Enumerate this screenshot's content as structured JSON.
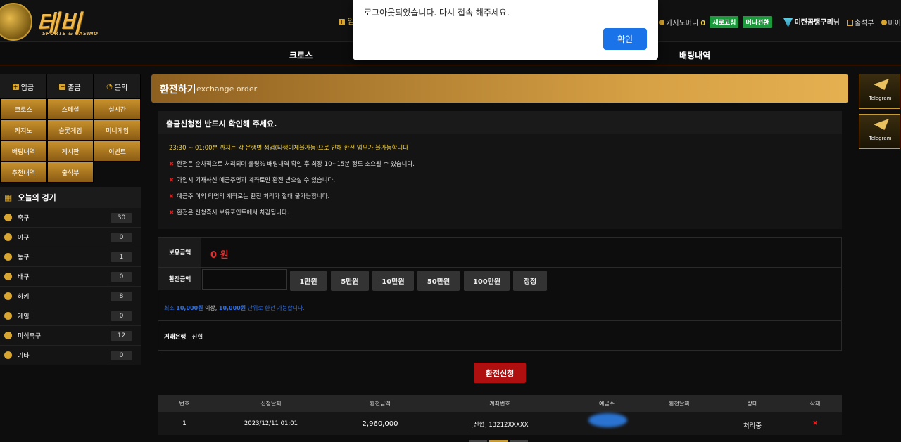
{
  "header": {
    "logo_text": "테비",
    "logo_sub": "SPORTS & CASINO",
    "deposit_partial": "입",
    "casino_money_label": "카지노머니",
    "casino_money_value": "0",
    "refresh_btn": "새로고침",
    "money_convert_btn": "머니전환",
    "user_name": "미련곰탱구리",
    "user_suffix": "님",
    "attendance": "출석부",
    "mypage_partial": "마이"
  },
  "nav": {
    "cross": "크로스",
    "betting_history": "배팅내역"
  },
  "dialog": {
    "message": "로그아웃되었습니다.  다시 접속 해주세요.",
    "ok": "확인"
  },
  "sidebar": {
    "top": [
      "입금",
      "출금",
      "문의"
    ],
    "grid": [
      "크로스",
      "스페셜",
      "실시간",
      "카지노",
      "슬롯게임",
      "미니게임",
      "배팅내역",
      "게시판",
      "이벤트",
      "추천내역",
      "출석부"
    ],
    "today_title": "오늘의 경기",
    "sports": [
      {
        "name": "축구",
        "count": "30"
      },
      {
        "name": "야구",
        "count": "0"
      },
      {
        "name": "농구",
        "count": "1"
      },
      {
        "name": "배구",
        "count": "0"
      },
      {
        "name": "하키",
        "count": "8"
      },
      {
        "name": "게임",
        "count": "0"
      },
      {
        "name": "미식축구",
        "count": "12"
      },
      {
        "name": "기타",
        "count": "0"
      }
    ]
  },
  "main": {
    "title": "환전하기",
    "title_en": "exchange order",
    "notice_head": "출금신청전 반드시 확인해 주세요.",
    "notice_lines": [
      "23:30 ~ 01:00분 까지는 각 은행별 점검(타행이체불가능)으로 인해 환전 업무가 불가능합니다",
      "환전은 순차적으로 처리되며 롤링% 배팅내역 확인 후 최장 10~15분 정도 소요될 수 있습니다.",
      "가입시 기재하신 예금주명과 계좌로만 환전 받으실 수 있습니다.",
      "예금주 이외 타명의 계좌로는 환전 처리가 절대 불가능합니다.",
      "환전은 신청즉시 보유포인트에서 차감됩니다."
    ],
    "hold_label": "보유금액",
    "hold_value": "0 원",
    "amount_label": "환전금액",
    "amount_value": "",
    "amount_buttons": [
      "1만원",
      "5만원",
      "10만원",
      "50만원",
      "100만원",
      "정정"
    ],
    "min_note_a": "최소",
    "min_note_b": "10,000원",
    "min_note_c": "이상,",
    "min_note_d": "10,000원",
    "min_note_e": "단위로 환전 가능합니다.",
    "bank_label": "거래은행",
    "bank_value": ": 신협",
    "apply_btn": "환전신청"
  },
  "table": {
    "headers": [
      "번호",
      "신청날짜",
      "환전금액",
      "계좌번호",
      "예금주",
      "환전날짜",
      "상태",
      "삭제"
    ],
    "row": {
      "no": "1",
      "date": "2023/12/11 01:01",
      "amount": "2,960,000",
      "account": "[신협] 13212XXXXX",
      "status": "처리중",
      "delete": "✖"
    }
  },
  "banners": [
    {
      "caption": "Telegram"
    },
    {
      "caption": "Telegram"
    }
  ]
}
